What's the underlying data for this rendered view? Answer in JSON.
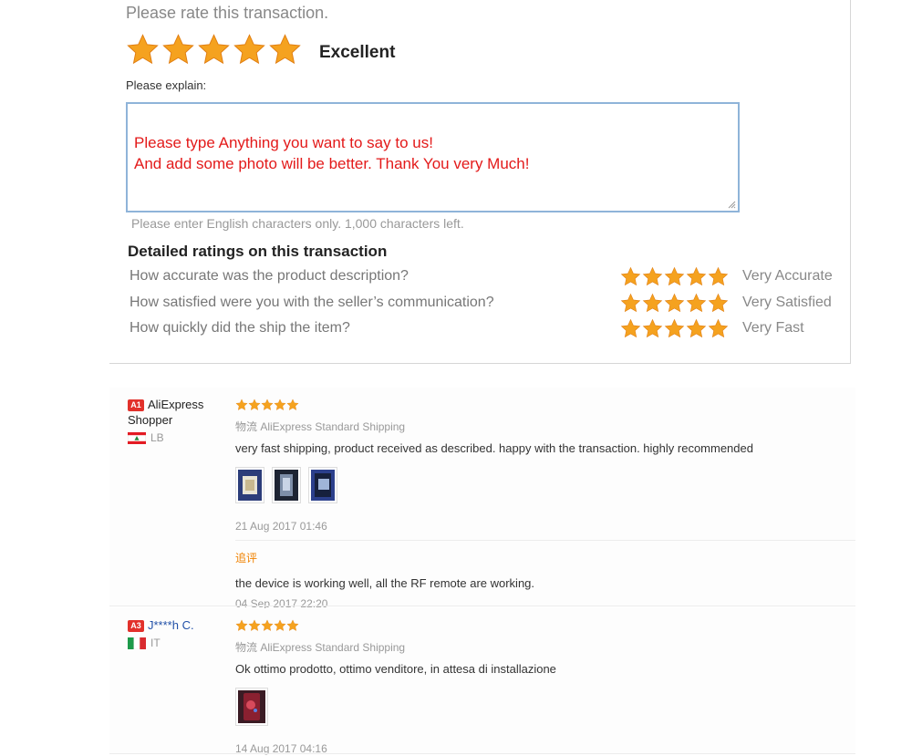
{
  "rating": {
    "title": "Please rate this transaction.",
    "stars": 5,
    "rating_word": "Excellent",
    "explain_label": "Please explain:",
    "textarea_text": "Please type Anything you want to say to us!\nAnd add some photo will be better. Thank You very Much!",
    "chars_hint": "Please enter English characters only. 1,000 characters left.",
    "detail_heading": "Detailed ratings on this transaction",
    "detailed": [
      {
        "question": "How accurate was the product description?",
        "stars": 5,
        "word": "Very Accurate"
      },
      {
        "question": "How satisfied were you with the seller’s communication?",
        "stars": 5,
        "word": "Very Satisfied"
      },
      {
        "question": "How quickly did the ship the item?",
        "stars": 5,
        "word": "Very Fast"
      }
    ],
    "colors": {
      "star": "#f5a21f",
      "textarea_text": "#e31a1a",
      "textarea_border": "#8fb4d9"
    }
  },
  "feedback": [
    {
      "level": "A1",
      "user": "AliExpress Shopper",
      "country": "LB",
      "stars": 5,
      "shipping": "物流 AliExpress Standard Shipping",
      "text": "very fast shipping, product received as described. happy with the transaction. highly recommended",
      "photo_count": 3,
      "date": "21 Aug 2017 01:46",
      "additional_label": "追评",
      "additional_text": "the device is working well, all the RF remote are working.",
      "additional_date": "04 Sep 2017 22:20"
    },
    {
      "level": "A3",
      "user": "J****h C.",
      "country": "IT",
      "stars": 5,
      "shipping": "物流 AliExpress Standard Shipping",
      "text": "Ok ottimo prodotto, ottimo venditore, in attesa di installazione",
      "photo_count": 1,
      "date": "14 Aug 2017 04:16"
    }
  ]
}
